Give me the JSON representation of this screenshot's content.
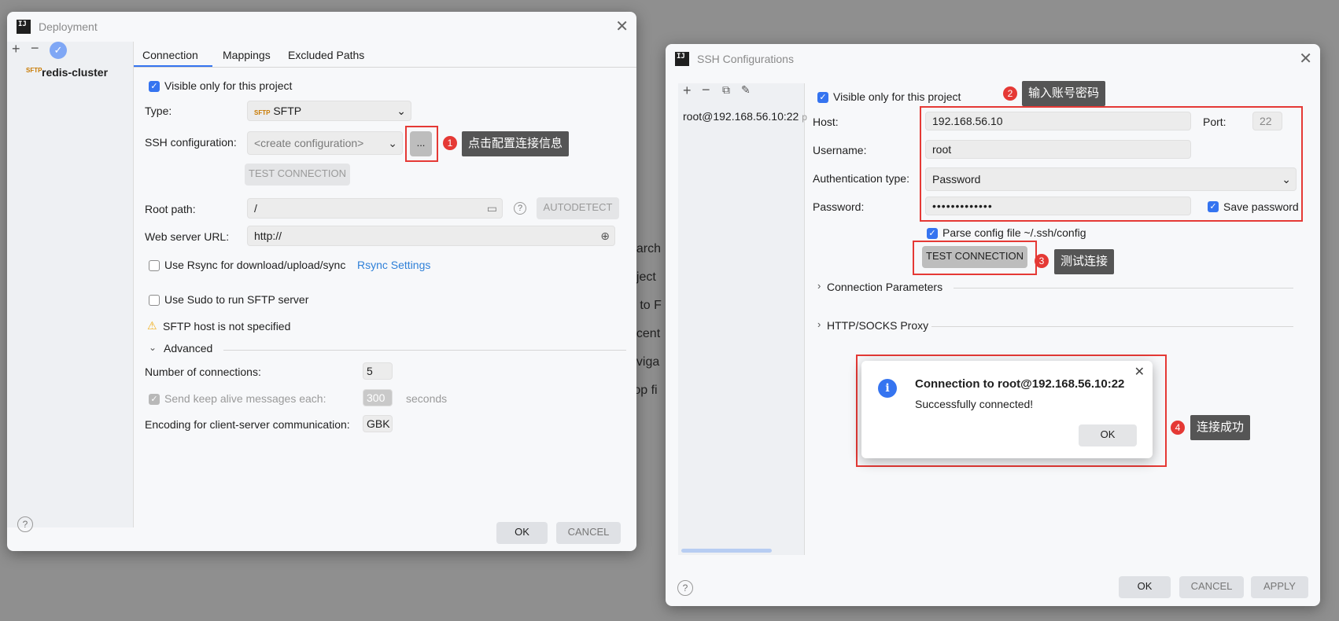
{
  "background_text": [
    "earch",
    "oject",
    "o to F",
    "ecent",
    "aviga",
    "rop fi"
  ],
  "deployment": {
    "title": "Deployment",
    "server_name": "redis-cluster",
    "tabs": [
      "Connection",
      "Mappings",
      "Excluded Paths"
    ],
    "visible_only": "Visible only for this project",
    "type_label": "Type:",
    "type_value": "SFTP",
    "ssh_label": "SSH configuration:",
    "ssh_value": "<create configuration>",
    "browse_label": "...",
    "test_connection": "TEST CONNECTION",
    "root_path_label": "Root path:",
    "root_path_value": "/",
    "autodetect": "AUTODETECT",
    "web_url_label": "Web server URL:",
    "web_url_value": "http://",
    "rsync_label": "Use Rsync for download/upload/sync",
    "rsync_settings": "Rsync Settings",
    "sudo_label": "Use Sudo to run SFTP server",
    "warning": "SFTP host is not specified",
    "advanced": "Advanced",
    "connections_label": "Number of connections:",
    "connections_value": "5",
    "keepalive_label": "Send keep alive messages each:",
    "keepalive_value": "300",
    "keepalive_unit": "seconds",
    "encoding_label": "Encoding for client-server communication:",
    "encoding_value": "GBK",
    "ok": "OK",
    "cancel": "CANCEL",
    "help": "?"
  },
  "ssh": {
    "title": "SSH Configurations",
    "list_item": "root@192.168.56.10:22",
    "list_item_suffix": "p",
    "visible_only": "Visible only for this project",
    "host_label": "Host:",
    "host_value": "192.168.56.10",
    "port_label": "Port:",
    "port_value": "22",
    "username_label": "Username:",
    "username_value": "root",
    "auth_label": "Authentication type:",
    "auth_value": "Password",
    "password_label": "Password:",
    "password_value": "•••••••••••••",
    "save_password": "Save password",
    "parse_config": "Parse config file ~/.ssh/config",
    "test_connection": "TEST CONNECTION",
    "conn_params": "Connection Parameters",
    "proxy": "HTTP/SOCKS Proxy",
    "ok": "OK",
    "cancel": "CANCEL",
    "apply": "APPLY",
    "help": "?"
  },
  "popup": {
    "title": "Connection to root@192.168.56.10:22",
    "message": "Successfully connected!",
    "ok": "OK"
  },
  "annotations": [
    {
      "number": "1",
      "text": "点击配置连接信息"
    },
    {
      "number": "2",
      "text": "输入账号密码"
    },
    {
      "number": "3",
      "text": "测试连接"
    },
    {
      "number": "4",
      "text": "连接成功"
    }
  ],
  "colors": {
    "accent": "#3574f0",
    "annotation_red": "#e53935",
    "tooltip_bg": "#555555",
    "link": "#2f80d8",
    "warning": "#f2b01e"
  }
}
